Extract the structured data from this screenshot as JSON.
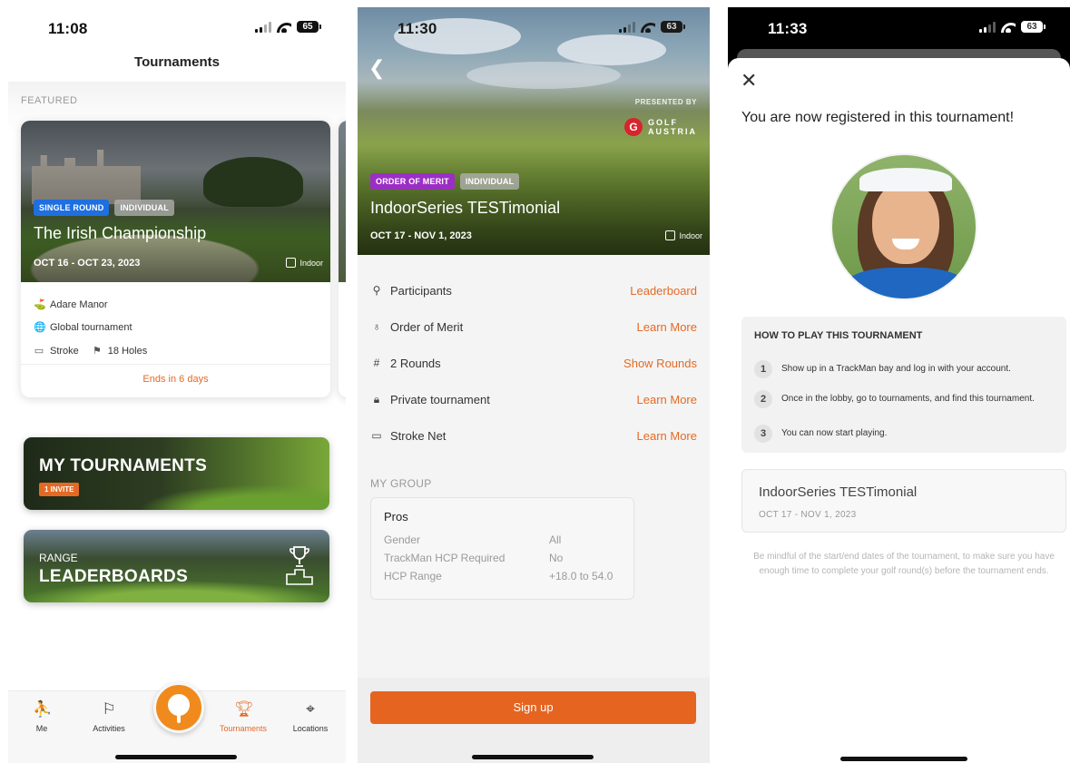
{
  "screen1": {
    "status": {
      "time": "11:08",
      "battery": "65"
    },
    "title": "Tournaments",
    "featured_label": "FEATURED",
    "featured": {
      "tags": [
        "SINGLE ROUND",
        "INDIVIDUAL"
      ],
      "name": "The Irish Championship",
      "dates": "OCT 16 - OCT 23, 2023",
      "venue_type": "Indoor",
      "course": "Adare Manor",
      "scope": "Global tournament",
      "format": "Stroke",
      "holes": "18 Holes",
      "ends": "Ends in 6 days"
    },
    "my_tournaments": {
      "title": "MY TOURNAMENTS",
      "badge": "1 INVITE"
    },
    "range": {
      "small": "RANGE",
      "big": "LEADERBOARDS"
    },
    "tabs": [
      {
        "label": "Me",
        "icon": "person-icon"
      },
      {
        "label": "Activities",
        "icon": "activities-icon"
      },
      {
        "label": "",
        "icon": "golf-ball-icon"
      },
      {
        "label": "Tournaments",
        "icon": "trophy-icon"
      },
      {
        "label": "Locations",
        "icon": "location-pin-icon"
      }
    ],
    "active_tab": "Tournaments"
  },
  "screen2": {
    "status": {
      "time": "11:30",
      "battery": "63"
    },
    "presented_by": "PRESENTED BY",
    "sponsor": {
      "logo_letter": "G",
      "line1": "GOLF",
      "line2": "AUSTRIA"
    },
    "tags": [
      "ORDER OF MERIT",
      "INDIVIDUAL"
    ],
    "name": "IndoorSeries TESTimonial",
    "dates": "OCT 17 - NOV 1, 2023",
    "venue_type": "Indoor",
    "rows": [
      {
        "label": "Participants",
        "action": "Leaderboard",
        "icon": "participants-icon"
      },
      {
        "label": "Order of Merit",
        "action": "Learn More",
        "icon": "medal-icon"
      },
      {
        "label": "2 Rounds",
        "action": "Show Rounds",
        "icon": "hash-icon"
      },
      {
        "label": "Private tournament",
        "action": "Learn More",
        "icon": "lock-icon"
      },
      {
        "label": "Stroke Net",
        "action": "Learn More",
        "icon": "scorecard-icon"
      }
    ],
    "my_group": {
      "label": "MY GROUP",
      "title": "Pros",
      "rows": [
        {
          "key": "Gender",
          "value": "All"
        },
        {
          "key": "TrackMan HCP Required",
          "value": "No"
        },
        {
          "key": "HCP Range",
          "value": "+18.0 to 54.0"
        }
      ]
    },
    "signup_label": "Sign up",
    "accent": "#e5641f"
  },
  "screen3": {
    "status": {
      "time": "11:33",
      "battery": "63"
    },
    "title": "You are now registered in this tournament!",
    "howto": {
      "title": "HOW TO PLAY THIS TOURNAMENT",
      "steps": [
        {
          "num": "1",
          "text": "Show up in a TrackMan bay and log in with your account."
        },
        {
          "num": "2",
          "text": "Once in the lobby, go to tournaments, and find this tournament."
        },
        {
          "num": "3",
          "text": "You can now start playing."
        }
      ]
    },
    "card": {
      "name": "IndoorSeries TESTimonial",
      "dates": "OCT 17 - NOV 1, 2023"
    },
    "note": "Be mindful of the start/end dates of the tournament, to make sure you have enough time to complete your golf round(s) before the tournament ends."
  }
}
